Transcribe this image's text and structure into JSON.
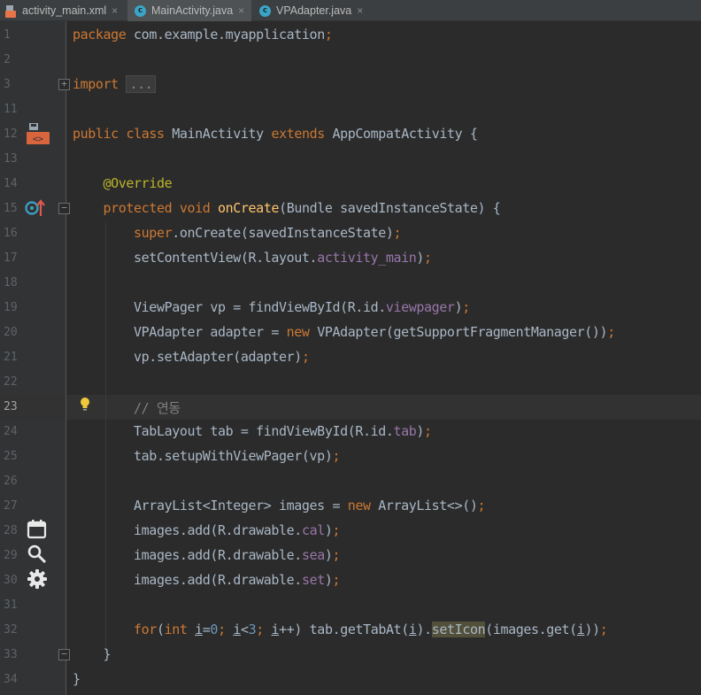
{
  "tabs": [
    {
      "label": "activity_main.xml",
      "icon": "xml-file-icon",
      "active": false
    },
    {
      "label": "MainActivity.java",
      "icon": "java-class-icon",
      "active": true
    },
    {
      "label": "VPAdapter.java",
      "icon": "java-class-icon",
      "active": false
    }
  ],
  "tab_close_glyph": "×",
  "class_icon_letter": "c",
  "fold_glyph_expand": "+",
  "fold_glyph_collapse": "−",
  "line_numbers": [
    "1",
    "2",
    "3",
    "11",
    "12",
    "13",
    "14",
    "15",
    "16",
    "17",
    "18",
    "19",
    "20",
    "21",
    "22",
    "23",
    "24",
    "25",
    "26",
    "27",
    "28",
    "29",
    "30",
    "31",
    "32",
    "33",
    "34"
  ],
  "current_line": "23",
  "code": {
    "l1": {
      "kw": "package",
      "rest": " com.example.myapplication",
      "semi": ";"
    },
    "l3": {
      "kw": "import",
      "dots": "..."
    },
    "l12": {
      "kw1": "public",
      "kw2": "class",
      "name": "MainActivity",
      "kw3": "extends",
      "rest": "AppCompatActivity {"
    },
    "l14": {
      "ann": "@Override"
    },
    "l15": {
      "kw1": "protected",
      "kw2": "void",
      "fn": "onCreate",
      "rest": "(Bundle savedInstanceState) {"
    },
    "l16": {
      "kw": "super",
      "rest": ".onCreate(savedInstanceState)",
      "semi": ";"
    },
    "l17": {
      "pre": "setContentView(R.layout.",
      "fld": "activity_main",
      "post": ")",
      "semi": ";"
    },
    "l19": {
      "pre": "ViewPager vp = findViewById(R.id.",
      "fld": "viewpager",
      "post": ")",
      "semi": ";"
    },
    "l20": {
      "pre": "VPAdapter adapter = ",
      "kw": "new",
      "post": " VPAdapter(getSupportFragmentManager())",
      "semi": ";"
    },
    "l21": {
      "pre": "vp.setAdapter(adapter)",
      "semi": ";"
    },
    "l23": {
      "comment": "// 연동"
    },
    "l24": {
      "pre": "TabLayout tab = findViewById(R.id.",
      "fld": "tab",
      "post": ")",
      "semi": ";"
    },
    "l25": {
      "pre": "tab.setupWithViewPager(vp)",
      "semi": ";"
    },
    "l27": {
      "pre": "ArrayList<Integer> images = ",
      "kw": "new",
      "post": " ArrayList<>()",
      "semi": ";"
    },
    "l28": {
      "pre": "images.add(R.drawable.",
      "fld": "cal",
      "post": ")",
      "semi": ";"
    },
    "l29": {
      "pre": "images.add(R.drawable.",
      "fld": "sea",
      "post": ")",
      "semi": ";"
    },
    "l30": {
      "pre": "images.add(R.drawable.",
      "fld": "set",
      "post": ")",
      "semi": ";"
    },
    "l32": {
      "kw1": "for",
      "p1": "(",
      "kw2": "int",
      "sp": " ",
      "var": "i",
      "eq": "=",
      "n0": "0",
      "s1": "; ",
      "var2": "i",
      "lt": "<",
      "n3": "3",
      "s2": "; ",
      "var3": "i",
      "inc": "++) tab.getTabAt(",
      "var4": "i",
      "mid": ").",
      "hl": "setIcon",
      "post1": "(images.get(",
      "var5": "i",
      "post2": "))",
      "semi": ";"
    },
    "l33": {
      "text": "}"
    },
    "l34": {
      "text": "}"
    }
  },
  "colors": {
    "keyword": "#cc7832",
    "annotation": "#bbb529",
    "method": "#ffc66d",
    "field": "#9876aa",
    "number": "#6897bb",
    "comment": "#808080",
    "text": "#a9b7c6",
    "background": "#2b2b2b"
  }
}
